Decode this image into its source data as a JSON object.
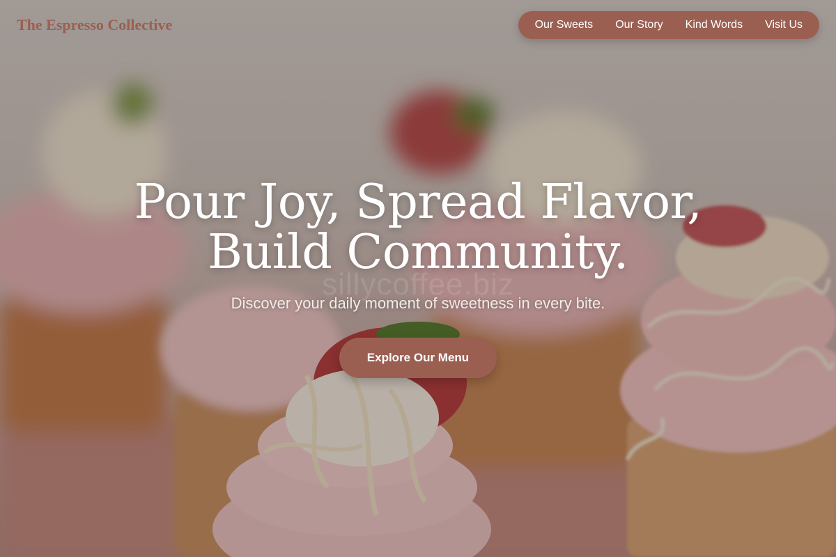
{
  "brand": {
    "name": "The Espresso Collective"
  },
  "nav": {
    "items": [
      {
        "label": "Our Sweets"
      },
      {
        "label": "Our Story"
      },
      {
        "label": "Kind Words"
      },
      {
        "label": "Visit Us"
      }
    ]
  },
  "hero": {
    "headline_line1": "Pour Joy, Spread Flavor,",
    "headline_line2": "Build Community.",
    "subheadline": "Discover your daily moment of sweetness in every bite.",
    "cta_label": "Explore Our Menu",
    "watermark": "sillycoffee.biz",
    "background_image": "blurred cupcakes with pink frosting, white chocolate drizzle and chocolate-dipped strawberries"
  },
  "colors": {
    "accent": "#9b5f52",
    "headline_text": "#ffffff",
    "brand_text": "#9b5f52"
  }
}
